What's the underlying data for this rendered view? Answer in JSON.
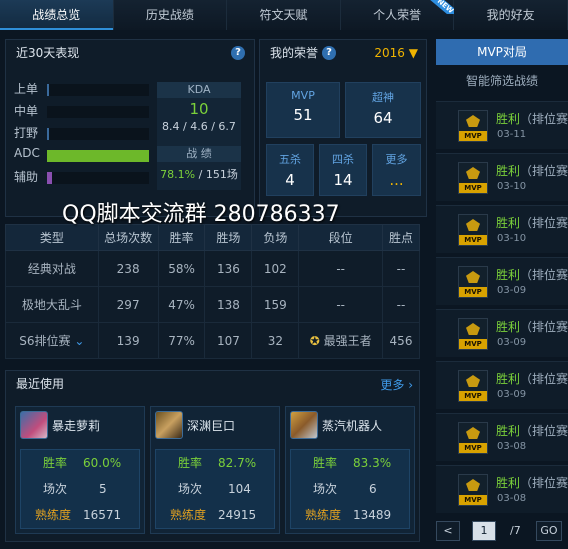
{
  "tabs": [
    "战绩总览",
    "历史战绩",
    "符文天赋",
    "个人荣誉",
    "我的好友"
  ],
  "new_badge": "NEW",
  "performance": {
    "title": "近30天表现",
    "help": "?",
    "roles": [
      {
        "label": "上单",
        "value": 0.02
      },
      {
        "label": "中单",
        "value": 0.0
      },
      {
        "label": "打野",
        "value": 0.02
      },
      {
        "label": "ADC",
        "value": 1.0,
        "color": "#6db82a"
      },
      {
        "label": "辅助",
        "value": 0.05,
        "color": "#8a4fb0"
      }
    ],
    "kda_label": "KDA",
    "kda_value": "10",
    "kda_detail": "8.4 / 4.6 / 6.7",
    "score_label": "战 绩",
    "score_rate": "78.1%",
    "score_sep": " / ",
    "score_total": "151场"
  },
  "honor": {
    "title": "我的荣誉",
    "help": "?",
    "year": "2016",
    "mvp_label": "MVP",
    "mvp_value": "51",
    "super_label": "超神",
    "super_value": "64",
    "penta_label": "五杀",
    "penta_value": "4",
    "quadra_label": "四杀",
    "quadra_value": "14",
    "more_label": "更多",
    "more_value": "..."
  },
  "watermark": "QQ脚本交流群 280786337",
  "stats_table": {
    "headers": [
      "类型",
      "总场次数",
      "胜率",
      "胜场",
      "负场",
      "段位",
      "胜点"
    ],
    "rows": [
      {
        "type": "经典对战",
        "total": "238",
        "rate": "58%",
        "wins": "136",
        "losses": "102",
        "rank": "--",
        "points": "--"
      },
      {
        "type": "极地大乱斗",
        "total": "297",
        "rate": "47%",
        "wins": "138",
        "losses": "159",
        "rank": "--",
        "points": "--"
      },
      {
        "type": "S6排位赛",
        "total": "139",
        "rate": "77%",
        "wins": "107",
        "losses": "32",
        "rank": "最强王者",
        "points": "456"
      }
    ]
  },
  "recent": {
    "title": "最近使用",
    "more": "更多",
    "heroes": [
      {
        "name": "暴走萝莉",
        "rate_label": "胜率",
        "rate": "60.0%",
        "games_label": "场次",
        "games": "5",
        "mastery_label": "熟练度",
        "mastery": "16571"
      },
      {
        "name": "深渊巨口",
        "rate_label": "胜率",
        "rate": "82.7%",
        "games_label": "场次",
        "games": "104",
        "mastery_label": "熟练度",
        "mastery": "24915"
      },
      {
        "name": "蒸汽机器人",
        "rate_label": "胜率",
        "rate": "83.3%",
        "games_label": "场次",
        "games": "6",
        "mastery_label": "熟练度",
        "mastery": "13489"
      }
    ]
  },
  "mvp_panel": {
    "title": "MVP对局",
    "filter": "智能筛选战绩",
    "tag": "MVP",
    "items": [
      {
        "result": "胜利",
        "mode": "（排位赛）",
        "date": "03-11"
      },
      {
        "result": "胜利",
        "mode": "（排位赛）",
        "date": "03-10"
      },
      {
        "result": "胜利",
        "mode": "（排位赛）",
        "date": "03-10"
      },
      {
        "result": "胜利",
        "mode": "（排位赛）",
        "date": "03-09"
      },
      {
        "result": "胜利",
        "mode": "（排位赛）",
        "date": "03-09"
      },
      {
        "result": "胜利",
        "mode": "（排位赛）",
        "date": "03-09"
      },
      {
        "result": "胜利",
        "mode": "（排位赛）",
        "date": "03-08"
      },
      {
        "result": "胜利",
        "mode": "（排位赛）",
        "date": "03-08"
      }
    ],
    "pager": {
      "prev": "<",
      "page": "1",
      "total": "/7",
      "go": "GO"
    }
  }
}
